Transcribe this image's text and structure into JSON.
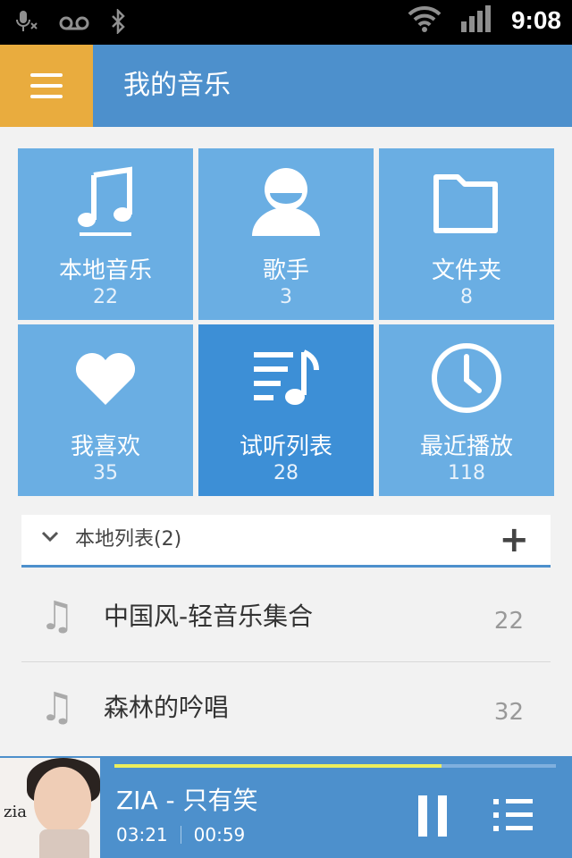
{
  "status_bar": {
    "time": "9:08",
    "icons": [
      "mic-muted-icon",
      "voicemail-icon",
      "bluetooth-icon",
      "wifi-icon",
      "signal-icon"
    ]
  },
  "app_bar": {
    "title": "我的音乐",
    "menu_icon": "hamburger-menu-icon"
  },
  "tiles": [
    {
      "label": "本地音乐",
      "count": "22",
      "icon": "music-note-icon"
    },
    {
      "label": "歌手",
      "count": "3",
      "icon": "singer-icon"
    },
    {
      "label": "文件夹",
      "count": "8",
      "icon": "folder-icon"
    },
    {
      "label": "我喜欢",
      "count": "35",
      "icon": "heart-icon"
    },
    {
      "label": "试听列表",
      "count": "28",
      "icon": "playlist-icon"
    },
    {
      "label": "最近播放",
      "count": "118",
      "icon": "clock-icon"
    }
  ],
  "local_list": {
    "title": "本地列表(2)",
    "add_label": "+",
    "items": [
      {
        "name": "中国风-轻音乐集合",
        "count": "22"
      },
      {
        "name": "森林的吟唱",
        "count": "32"
      }
    ]
  },
  "player": {
    "album_text": "zia",
    "track": "ZIA - 只有笑",
    "current_time": "03:21",
    "remaining_time": "00:59",
    "progress": 0.74
  },
  "colors": {
    "accent": "#4d90cc",
    "menu": "#e9ac3e",
    "tile": "#6aaee3",
    "tile_active": "#3d8fd6",
    "progress": "#ecee5d"
  }
}
